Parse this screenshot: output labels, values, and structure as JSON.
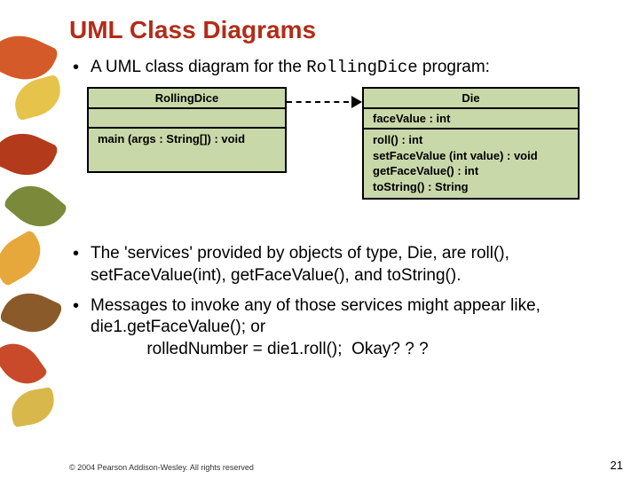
{
  "title": "UML Class Diagrams",
  "bullet1_pre": "A UML class diagram for the ",
  "bullet1_code": "RollingDice",
  "bullet1_post": " program:",
  "uml": {
    "left": {
      "name": "RollingDice",
      "attrs": " ",
      "methods": "main (args : String[]) : void"
    },
    "right": {
      "name": "Die",
      "attrs": "faceValue : int",
      "m1": "roll() : int",
      "m2": "setFaceValue (int value) : void",
      "m3": "getFaceValue() : int",
      "m4": "toString() : String"
    }
  },
  "bullet2": "The 'services' provided by objects of type, Die, are roll(), setFaceValue(int), getFaceValue(), and toString().",
  "bullet3_l1": "Messages to invoke any of those services might appear like,  die1.getFaceValue();  or",
  "bullet3_l2": "            rolledNumber = die1.roll();  Okay? ? ?",
  "footer": "© 2004 Pearson Addison-Wesley. All rights reserved",
  "page": "21"
}
